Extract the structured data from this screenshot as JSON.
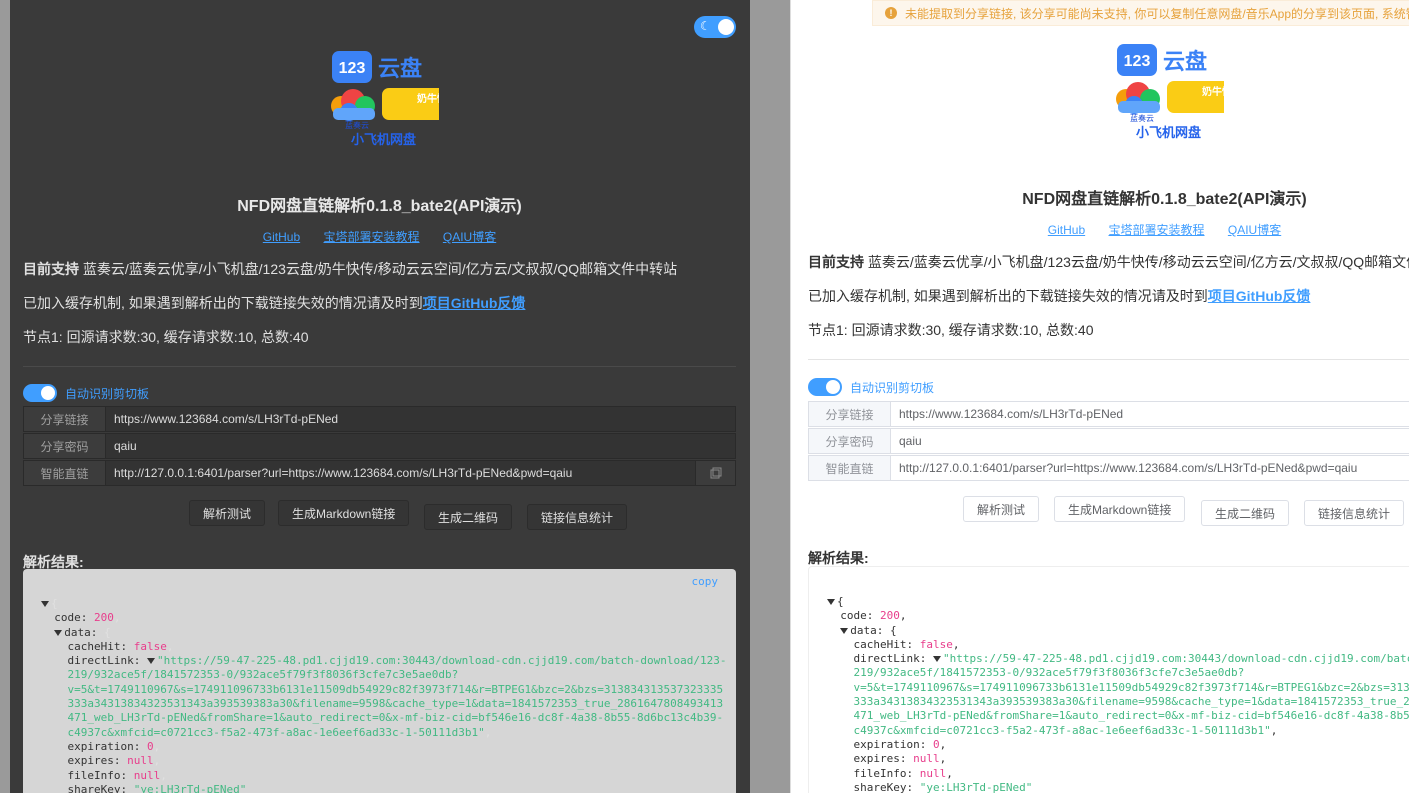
{
  "logo": {
    "brand_123": "123",
    "brand_yunpan": "云盘",
    "brand_lanzou": "蓝奏云",
    "brand_nainiu": "奶牛快传",
    "brand_feiji": "小飞机网盘"
  },
  "title": "NFD网盘直链解析0.1.8_bate2(API演示)",
  "links": {
    "github": "GitHub",
    "baota": "宝塔部署安装教程",
    "blog": "QAIU博客"
  },
  "support": {
    "label": "目前支持",
    "text": "蓝奏云/蓝奏云优享/小飞机盘/123云盘/奶牛快传/移动云云空间/亿方云/文叔叔/QQ邮箱文件中转站"
  },
  "cache": {
    "text": "已加入缓存机制, 如果遇到解析出的下载链接失效的情况请及时到",
    "link": "项目GitHub反馈"
  },
  "node_stats": "节点1: 回源请求数:30, 缓存请求数:10, 总数:40",
  "clipboard_toggle_label": "自动识别剪切板",
  "form": {
    "share_link_label": "分享链接",
    "share_link_value": "https://www.123684.com/s/LH3rTd-pENed",
    "share_pwd_label": "分享密码",
    "share_pwd_value": "qaiu",
    "smart_link_label": "智能直链",
    "smart_link_value": "http://127.0.0.1:6401/parser?url=https://www.123684.com/s/LH3rTd-pENed&pwd=qaiu"
  },
  "buttons": {
    "parse_test": "解析测试",
    "markdown": "生成Markdown链接",
    "qrcode": "生成二维码",
    "stats": "链接信息统计"
  },
  "result": {
    "title": "解析结果:",
    "copy_label": "copy",
    "code": "200",
    "cacheHit": "false",
    "directLink_1": "\"https://59-47-225-48.pd1.cjjd19.com:30443/download-cdn.cjjd19.com/batch-download/123-",
    "directLink_2": "219/932ace5f/1841572353-0/932ace5f79f3f8036f3cfe7c3e5ae0db?",
    "directLink_3": "v=5&t=1749110967&s=174911096733b6131e11509db54929c82f3973f714&r=BTPEG1&bzc=2&bzs=313834313537323335",
    "directLink_4": "333a34313834323531343a393539383a30&filename=9598&cache_type=1&data=1841572353_true_2861647808493413",
    "directLink_5": "471_web_LH3rTd-pENed&fromShare=1&auto_redirect=0&x-mf-biz-cid=bf546e16-dc8f-4a38-8b55-8d6bc13c4b39-",
    "directLink_6": "c4937c&xmfcid=c0721cc3-f5a2-473f-a8ac-1e6eef6ad33c-1-50111d3b1\"",
    "expiration": "0",
    "expires": "null",
    "fileInfo": "null",
    "shareKey": "\"ye:LH3rTd-pENed\""
  },
  "alert_text": "未能提取到分享链接, 该分享可能尚未支持, 你可以复制任意网盘/音乐App的分享到该页面, 系统智"
}
